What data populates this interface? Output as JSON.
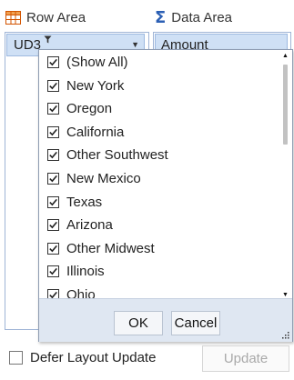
{
  "row_area": {
    "header_label": "Row Area",
    "field_chip": "UD3"
  },
  "data_area": {
    "header_label": "Data Area",
    "field_chip": "Amount"
  },
  "filter_list": {
    "items": [
      {
        "label": "(Show All)",
        "checked": true
      },
      {
        "label": "New York",
        "checked": true
      },
      {
        "label": "Oregon",
        "checked": true
      },
      {
        "label": "California",
        "checked": true
      },
      {
        "label": "Other Southwest",
        "checked": true
      },
      {
        "label": "New Mexico",
        "checked": true
      },
      {
        "label": "Texas",
        "checked": true
      },
      {
        "label": "Arizona",
        "checked": true
      },
      {
        "label": "Other Midwest",
        "checked": true
      },
      {
        "label": "Illinois",
        "checked": true
      },
      {
        "label": "Ohio",
        "checked": true
      }
    ],
    "ok_label": "OK",
    "cancel_label": "Cancel"
  },
  "bottom": {
    "defer_label": "Defer Layout Update",
    "defer_checked": false,
    "update_label": "Update"
  },
  "colors": {
    "accent": "#2b5fb4",
    "chip_bg": "#cfe0f5",
    "panel_border": "#9fb4d6",
    "footer_bg": "#dfe7f2"
  },
  "icons": {
    "row_area": "table-grid-icon",
    "data_area": "sigma-icon",
    "filter": "filter-icon",
    "dropdown": "chevron-down-icon"
  }
}
